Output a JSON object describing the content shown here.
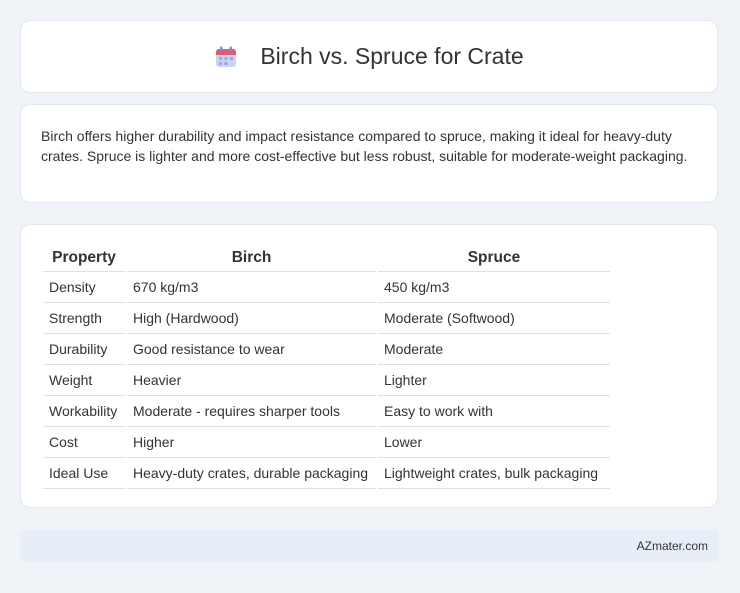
{
  "header": {
    "title": "Birch vs. Spruce for Crate",
    "icon": "calendar-icon"
  },
  "summary": {
    "text": "Birch offers higher durability and impact resistance compared to spruce, making it ideal for heavy-duty crates. Spruce is lighter and more cost-effective but less robust, suitable for moderate-weight packaging."
  },
  "table": {
    "headers": [
      "Property",
      "Birch",
      "Spruce"
    ],
    "rows": [
      [
        "Density",
        "670 kg/m3",
        "450 kg/m3"
      ],
      [
        "Strength",
        "High (Hardwood)",
        "Moderate (Softwood)"
      ],
      [
        "Durability",
        "Good resistance to wear",
        "Moderate"
      ],
      [
        "Weight",
        "Heavier",
        "Lighter"
      ],
      [
        "Workability",
        "Moderate - requires sharper tools",
        "Easy to work with"
      ],
      [
        "Cost",
        "Higher",
        "Lower"
      ],
      [
        "Ideal Use",
        "Heavy-duty crates, durable packaging",
        "Lightweight crates, bulk packaging"
      ]
    ]
  },
  "footer": {
    "text": "AZmater.com"
  }
}
